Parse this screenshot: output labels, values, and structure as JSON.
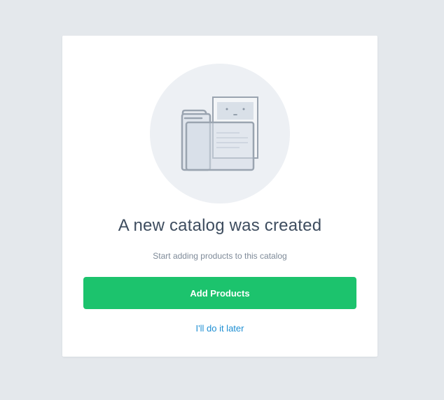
{
  "dialog": {
    "illustration_icon": "folder-with-document-icon",
    "title": "A new catalog was created",
    "subtitle": "Start adding products to this catalog",
    "primary_button_label": "Add Products",
    "secondary_link_label": "I'll do it later"
  },
  "colors": {
    "page_background": "#e4e8ec",
    "card_background": "#ffffff",
    "primary_button": "#1cc36d",
    "link": "#1e8fd3",
    "title_text": "#3e4d5f",
    "subtitle_text": "#7e8a98"
  }
}
